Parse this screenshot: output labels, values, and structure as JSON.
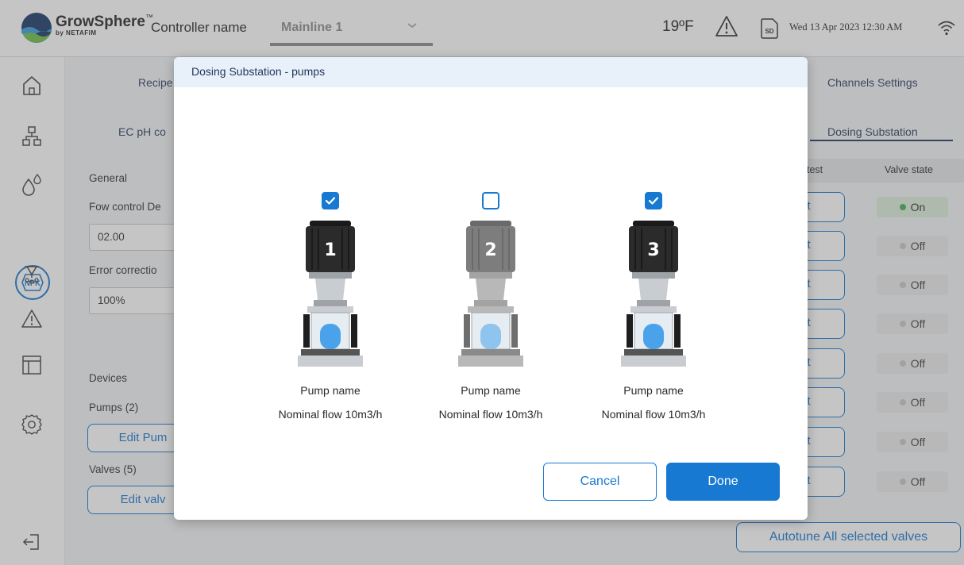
{
  "topbar": {
    "brand_main": "GrowSphere",
    "brand_tm": "™",
    "brand_by": "by NETAFIM",
    "controller_label": "Controller name",
    "controller_value": "Mainline 1",
    "temperature": "19ºF",
    "sd_label": "SD",
    "datetime": "Wed 13 Apr 2023  12:30 AM"
  },
  "sidebar": {
    "npk_label": "NPK"
  },
  "background": {
    "tab_recipe": "Recipe",
    "tab_channels": "Channels Settings",
    "tab_ec": "EC pH co",
    "tab_dosing": "Dosing Substation",
    "section_general": "General",
    "flow_label": "Fow control De",
    "flow_value": "02.00",
    "error_label": "Error correctio",
    "error_value": "100%",
    "section_devices": "Devices",
    "pumps_count": "Pumps (2)",
    "edit_pumps": "Edit Pum",
    "valves_count": "Valves (5)",
    "edit_valves": "Edit valv",
    "col_test": "test",
    "col_valve_state": "Valve state",
    "test_label": "st",
    "valve_states": [
      "On",
      "Off",
      "Off",
      "Off",
      "Off",
      "Off",
      "Off",
      "Off"
    ],
    "autotune": "Autotune All selected valves"
  },
  "modal": {
    "title": "Dosing Substation - pumps",
    "pumps": [
      {
        "number": "1",
        "checked": true,
        "name": "Pump name",
        "flow": "Nominal flow 10m3/h"
      },
      {
        "number": "2",
        "checked": false,
        "name": "Pump name",
        "flow": "Nominal flow 10m3/h"
      },
      {
        "number": "3",
        "checked": true,
        "name": "Pump name",
        "flow": "Nominal flow 10m3/h"
      }
    ],
    "cancel_label": "Cancel",
    "done_label": "Done"
  },
  "colors": {
    "accent": "#1779d1",
    "on_dot": "#4caf50",
    "off_dot": "#c8c8c8"
  }
}
